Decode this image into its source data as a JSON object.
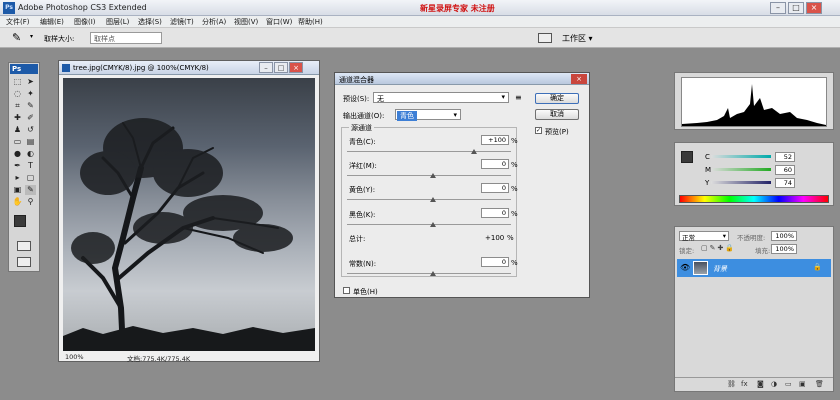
{
  "app": {
    "title": "Adobe Photoshop CS3 Extended",
    "watermark": "新星录屏专家 未注册",
    "icon_text": "Ps"
  },
  "window_buttons": [
    "–",
    "□",
    "×"
  ],
  "menu": [
    "文件(F)",
    "编辑(E)",
    "图像(I)",
    "图层(L)",
    "选择(S)",
    "滤镜(T)",
    "分析(A)",
    "视图(V)",
    "窗口(W)",
    "帮助(H)"
  ],
  "options_bar": {
    "sample_size_label": "取样大小:",
    "sample_size_value": "取样点",
    "workspace": "工作区 ▾"
  },
  "toolbox": {
    "badge": "Ps"
  },
  "document": {
    "title": "tree.jpg(CMYK/8).jpg @ 100%(CMYK/8)",
    "zoom": "100%",
    "doc_info": "文档:775.4K/775.4K"
  },
  "dialog": {
    "title": "通道混合器",
    "preset_label": "预设(S):",
    "preset_value": "无",
    "output_label": "输出通道(O):",
    "output_value": "青色",
    "source_label": "源通道",
    "channels": [
      {
        "label": "青色(C):",
        "value": "+100",
        "pct": "%",
        "pos": 1.0
      },
      {
        "label": "洋红(M):",
        "value": "0",
        "pct": "%",
        "pos": 0.5
      },
      {
        "label": "黄色(Y):",
        "value": "0",
        "pct": "%",
        "pos": 0.5
      },
      {
        "label": "黑色(K):",
        "value": "0",
        "pct": "%",
        "pos": 0.5
      }
    ],
    "total_label": "总计:",
    "total_value": "+100",
    "total_pct": "%",
    "constant_label": "常数(N):",
    "constant_value": "0",
    "constant_pct": "%",
    "constant_pos": 0.5,
    "mono_label": "单色(H)",
    "ok": "确定",
    "cancel": "取消",
    "preview_label": "预览(P)"
  },
  "color_panel": {
    "rows": [
      {
        "letter": "C",
        "value": "52"
      },
      {
        "letter": "M",
        "value": "60"
      },
      {
        "letter": "Y",
        "value": "74"
      }
    ]
  },
  "layers_panel": {
    "blend_mode": "正常",
    "opacity_label": "不透明度:",
    "opacity_value": "100%",
    "lock_label": "锁定:",
    "fill_label": "填充:",
    "fill_value": "100%",
    "layer_name": "背景"
  },
  "colors": {
    "accent": "#3d8ee0",
    "watermark": "#d01010"
  }
}
